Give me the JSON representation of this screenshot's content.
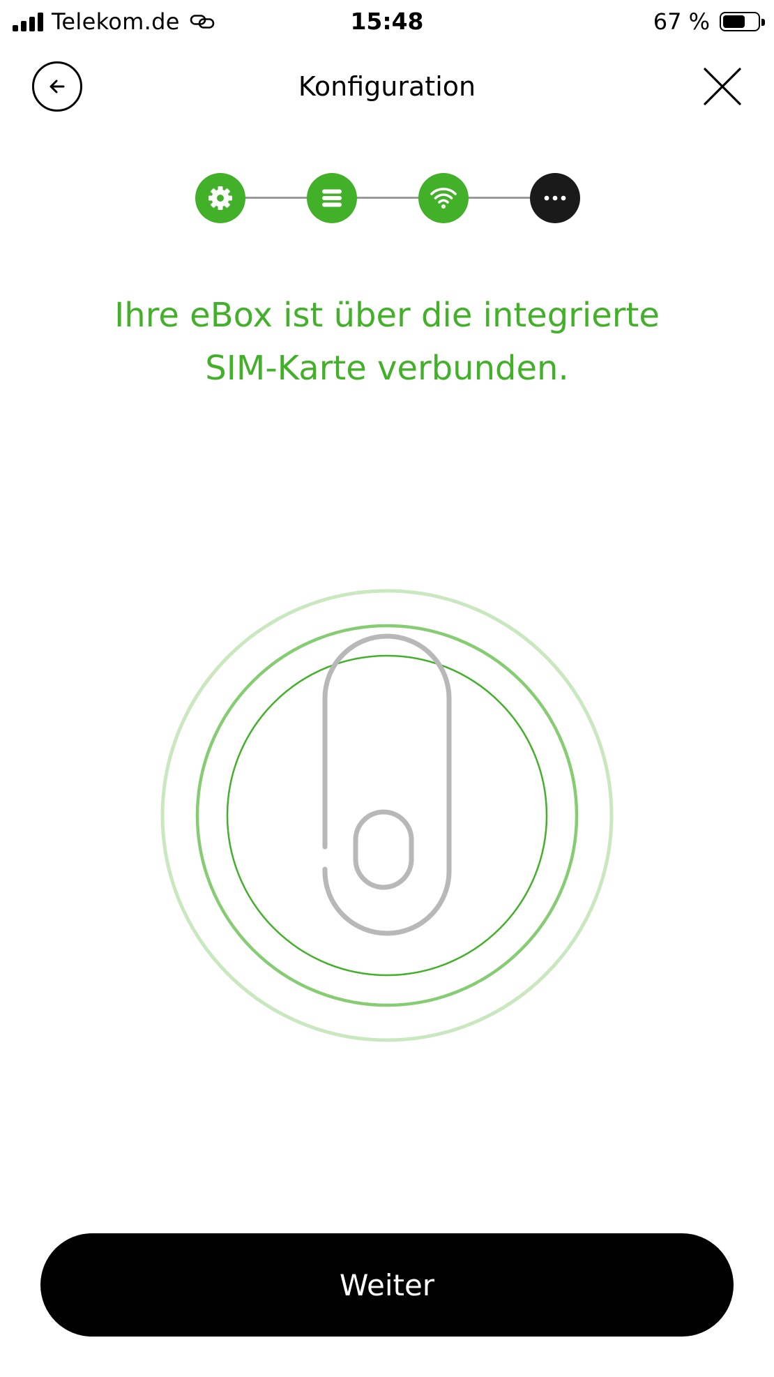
{
  "status_bar": {
    "carrier": "Telekom.de",
    "time": "15:48",
    "battery_percent": "67 %",
    "battery_level": 0.67,
    "signal_bars": 4,
    "icons": [
      "signal-icon",
      "link-icon",
      "battery-icon"
    ]
  },
  "nav": {
    "title": "Konfiguration",
    "back_icon": "arrow-left-circle-icon",
    "close_icon": "close-icon"
  },
  "stepper": {
    "steps": [
      {
        "icon": "gear-icon",
        "state": "done"
      },
      {
        "icon": "list-icon",
        "state": "done"
      },
      {
        "icon": "wifi-icon",
        "state": "done"
      },
      {
        "icon": "more-icon",
        "state": "current"
      }
    ]
  },
  "headline": {
    "line1": "Ihre eBox ist über die integrierte",
    "line2": "SIM-Karte verbunden."
  },
  "illustration": {
    "icon": "ebox-device-icon"
  },
  "primary_button": {
    "label": "Weiter"
  },
  "colors": {
    "accent": "#43b02a",
    "ring_light": "#c9e8bf",
    "ring_mid": "#86cc73",
    "device_gray": "#b8b8b8",
    "button_bg": "#000000",
    "step_current": "#1a1a1a"
  }
}
